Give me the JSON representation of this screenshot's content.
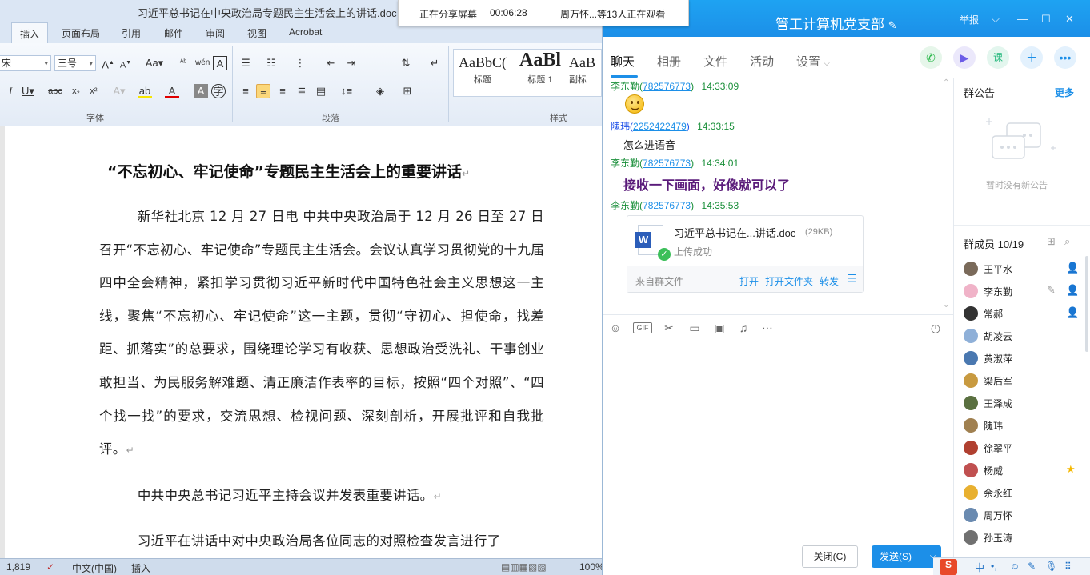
{
  "share_bar": {
    "status": "正在分享屏幕",
    "timer": "00:06:28",
    "viewers": "周万怀...等13人正在观看"
  },
  "word": {
    "title": "习近平总书记在中央政治局专题民主生活会上的讲话.doc [兼容",
    "tabs": [
      "插入",
      "页面布局",
      "引用",
      "邮件",
      "审阅",
      "视图",
      "Acrobat"
    ],
    "font_size": "三号",
    "font_name": "宋",
    "groups": {
      "font": "字体",
      "paragraph": "段落",
      "styles": "样式"
    },
    "styles": [
      {
        "sample": "AaBbC(",
        "name": "标题"
      },
      {
        "sample": "AaBl",
        "name": "标题 1"
      },
      {
        "sample": "AaB",
        "name": "副标"
      }
    ],
    "doc_title": "“不忘初心、牢记使命”专题民主生活会上的重要讲话",
    "paragraphs": [
      "新华社北京 12 月 27 日电 中共中央政治局于 12 月 26 日至 27 日召开“不忘初心、牢记使命”专题民主生活会。会议认真学习贯彻党的十九届四中全会精神，紧扣学习贯彻习近平新时代中国特色社会主义思想这一主线，聚焦“不忘初心、牢记使命”这一主题，贯彻“守初心、担使命，找差距、抓落实”的总要求，围绕理论学习有收获、思想政治受洗礼、干事创业敢担当、为民服务解难题、清正廉洁作表率的目标，按照“四个对照”、“四个找一找”的要求，交流思想、检视问题、深刻剖析，开展批评和自我批评。",
      "中共中央总书记习近平主持会议并发表重要讲话。",
      "习近平在讲话中对中央政治局各位同志的对照检查发言进行了"
    ],
    "status": {
      "words": "1,819",
      "lang": "中文(中国)",
      "mode": "插入",
      "zoom": "100%"
    }
  },
  "qq": {
    "group_name": "管工计算机党支部",
    "report": "举报",
    "nav": [
      "聊天",
      "相册",
      "文件",
      "活动",
      "设置"
    ],
    "messages": [
      {
        "sender": "李东勤",
        "qq": "782576773",
        "time": "14:33:09",
        "content": ""
      },
      {
        "sender": "隗玮",
        "qq": "2252422479",
        "time": "14:33:15",
        "content": "怎么进语音"
      },
      {
        "sender": "李东勤",
        "qq": "782576773",
        "time": "14:34:01",
        "content": "接收一下画面，好像就可以了"
      },
      {
        "sender": "李东勤",
        "qq": "782576773",
        "time": "14:35:53",
        "content": ""
      }
    ],
    "file": {
      "name": "习近平总书记在...讲话.doc",
      "size": "(29KB)",
      "status": "上传成功",
      "source": "来自群文件",
      "open": "打开",
      "open_folder": "打开文件夹",
      "forward": "转发"
    },
    "buttons": {
      "close": "关闭(C)",
      "send": "发送(S)"
    },
    "notice": {
      "title": "群公告",
      "more": "更多",
      "empty": "暂时没有新公告"
    },
    "members_title": "群成员 10/19",
    "members": [
      {
        "name": "王平水",
        "color": "#7a6a5a",
        "role": "admin"
      },
      {
        "name": "李东勤",
        "color": "#f0b3c8",
        "role": "admin"
      },
      {
        "name": "常郝",
        "color": "#333333",
        "role": "admin"
      },
      {
        "name": "胡凌云",
        "color": "#8fb0d8",
        "role": ""
      },
      {
        "name": "黄淑萍",
        "color": "#4a78b0",
        "role": ""
      },
      {
        "name": "梁后军",
        "color": "#c89a40",
        "role": ""
      },
      {
        "name": "王泽成",
        "color": "#5a7040",
        "role": ""
      },
      {
        "name": "隗玮",
        "color": "#a08050",
        "role": ""
      },
      {
        "name": "徐翠平",
        "color": "#b04030",
        "role": ""
      },
      {
        "name": "杨威",
        "color": "#c05050",
        "role": "owner"
      },
      {
        "name": "余永红",
        "color": "#e8b030",
        "role": ""
      },
      {
        "name": "周万怀",
        "color": "#6a8ab0",
        "role": ""
      },
      {
        "name": "孙玉涛",
        "color": "#707070",
        "role": ""
      }
    ]
  },
  "tray": [
    "中"
  ]
}
